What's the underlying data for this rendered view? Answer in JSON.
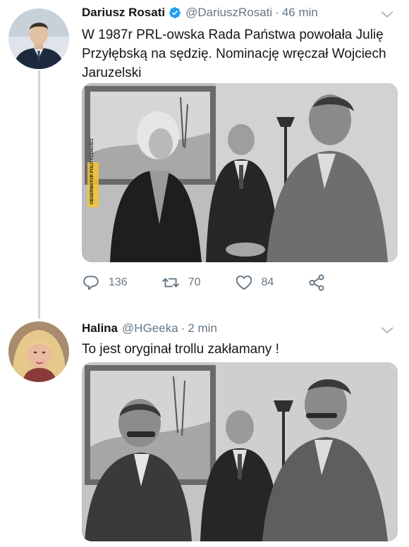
{
  "tweets": [
    {
      "author_name": "Dariusz Rosati",
      "handle": "@DariuszRosati",
      "separator": "·",
      "time": "46 min",
      "text": "W 1987r  PRL-owska Rada Państwa powołała Julię Przyłębską na sędzię. Nominację wręczał Wojciech Jaruzelski",
      "verified": true,
      "photo_watermark": "OBSERWATOR POLITYCZNOŚCI",
      "actions": {
        "replies": "136",
        "retweets": "70",
        "likes": "84"
      },
      "icons": [
        "reply-icon",
        "retweet-icon",
        "like-icon",
        "share-icon",
        "chevron-down-icon",
        "verified-icon"
      ]
    },
    {
      "author_name": "Halina",
      "handle": "@HGeeka",
      "separator": "·",
      "time": "2 min",
      "text": "To jest oryginał trollu zakłamany !",
      "verified": false
    }
  ],
  "colors": {
    "text": "#14171a",
    "secondary": "#657786",
    "verified": "#1da1f2",
    "thread_line": "#ccd6dd"
  }
}
